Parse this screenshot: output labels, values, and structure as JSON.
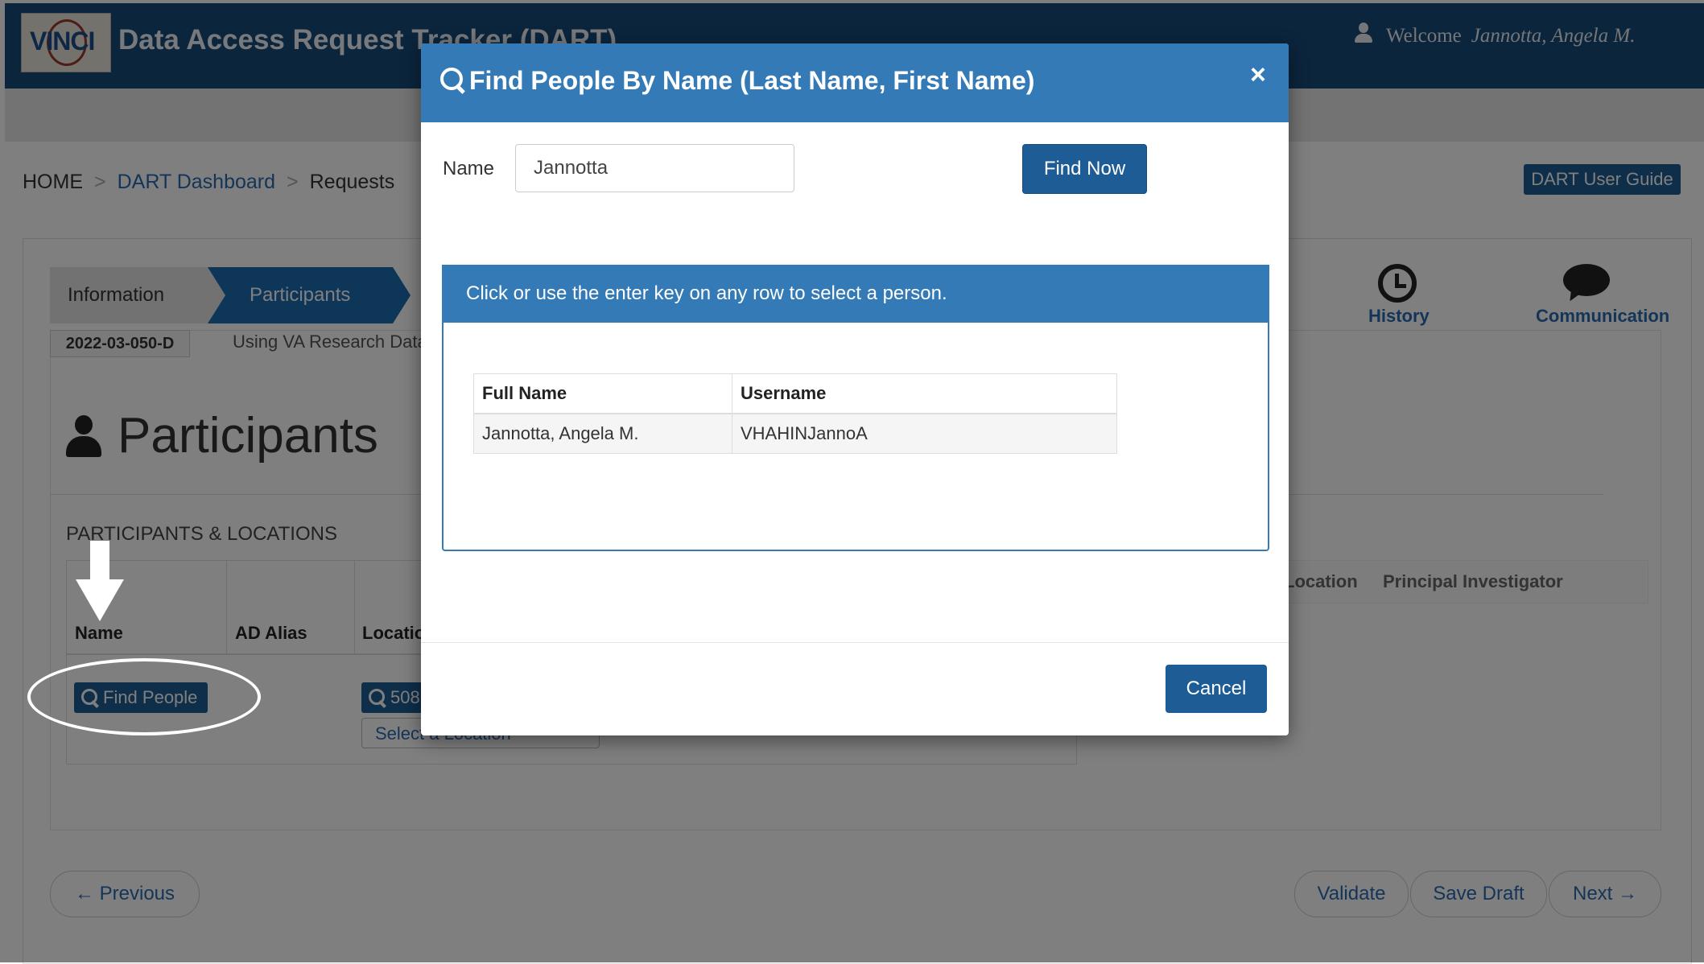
{
  "header": {
    "logo_text": "VINCI",
    "app_title": "Data Access Request Tracker (DART)",
    "welcome_label": "Welcome",
    "user_name": "Jannotta,   Angela   M."
  },
  "breadcrumb": {
    "home": "HOME",
    "dashboard": "DART Dashboard",
    "requests": "Requests",
    "separator": ">"
  },
  "user_guide_label": "DART User Guide",
  "steps": {
    "information": "Information",
    "participants": "Participants"
  },
  "request": {
    "id": "2022-03-050-D",
    "title": "Using VA Research Data"
  },
  "side_tabs": {
    "history": "History",
    "communication": "Communication"
  },
  "page": {
    "heading": "Participants",
    "section_label": "PARTICIPANTS & LOCATIONS"
  },
  "participants_table": {
    "columns": [
      "Name",
      "AD Alias",
      "Location",
      "Location",
      "Principal Investigator"
    ],
    "find_people_label": "Find People",
    "location_button_label": "508",
    "location_select_placeholder": "Select a Location"
  },
  "nav": {
    "previous": "← Previous",
    "validate": "Validate",
    "save_draft": "Save Draft",
    "next": "Next →"
  },
  "modal": {
    "title": "Find People By Name (Last Name, First Name)",
    "close_glyph": "×",
    "name_label": "Name",
    "name_value": "Jannotta",
    "find_now_label": "Find Now",
    "instructions": "Click or use the enter key on any row to select a person.",
    "results": {
      "columns": [
        "Full Name",
        "Username"
      ],
      "rows": [
        [
          "Jannotta, Angela M.",
          "VHAHINJannoA"
        ]
      ]
    },
    "cancel_label": "Cancel"
  }
}
